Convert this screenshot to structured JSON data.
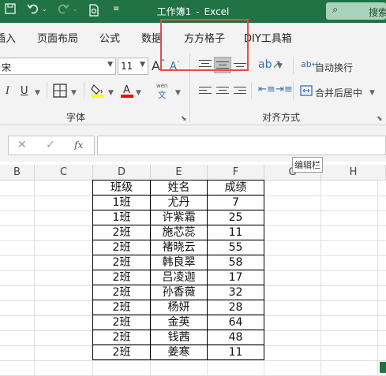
{
  "titlebar": {
    "document": "工作簿1",
    "separator": "-",
    "app": "Excel",
    "search_label": "搜索"
  },
  "tabs": [
    "插入",
    "页面布局",
    "公式",
    "数据",
    "方方格子",
    "DIY工具箱"
  ],
  "ribbon": {
    "font_name_value": "宋",
    "font_size_value": "11",
    "font_group_label": "字体",
    "align_group_label": "对齐方式",
    "wrap_text_label": "自动换行",
    "merge_center_label": "合并后居中",
    "phonetic_top": "wén",
    "phonetic_bottom": "文"
  },
  "formula_bar": {
    "fx_label": "fx",
    "tooltip": "编辑栏"
  },
  "columns": [
    "B",
    "C",
    "D",
    "E",
    "F",
    "G",
    "H"
  ],
  "table": {
    "header": [
      "班级",
      "姓名",
      "成绩"
    ],
    "rows": [
      [
        "1班",
        "尤丹",
        "7"
      ],
      [
        "1班",
        "许紫霜",
        "25"
      ],
      [
        "2班",
        "施芯蕊",
        "11"
      ],
      [
        "2班",
        "褚晓云",
        "55"
      ],
      [
        "2班",
        "韩良翠",
        "58"
      ],
      [
        "2班",
        "吕凌迦",
        "17"
      ],
      [
        "2班",
        "孙香薇",
        "32"
      ],
      [
        "2班",
        "杨妍",
        "28"
      ],
      [
        "2班",
        "金英",
        "64"
      ],
      [
        "2班",
        "钱茜",
        "48"
      ],
      [
        "2班",
        "姜寒",
        "11"
      ]
    ]
  },
  "colors": {
    "excel_green": "#217346",
    "highlight_red": "#e84b4b",
    "fill_yellow": "#ffff00",
    "font_red": "#ff0000"
  }
}
